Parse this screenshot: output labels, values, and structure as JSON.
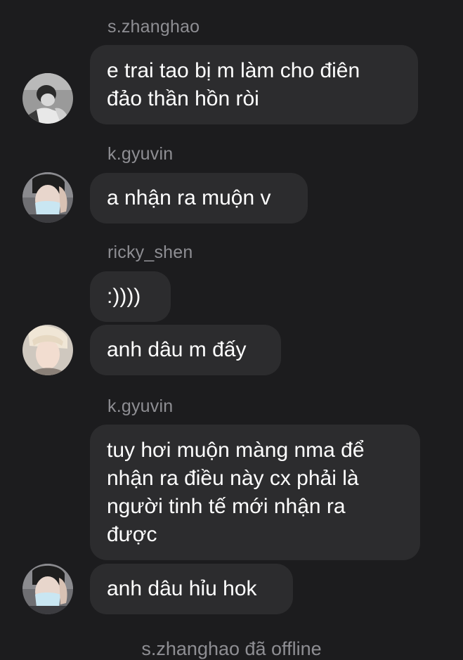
{
  "messages": [
    {
      "sender": "s.zhanghao",
      "text": "e trai tao bị m làm cho điên\nđảo thần hồn ròi",
      "avatar": "avatar-zhanghao"
    },
    {
      "sender": "k.gyuvin",
      "text": "a nhận ra muộn v",
      "avatar": "avatar-gyuvin"
    },
    {
      "sender": "ricky_shen",
      "text": ":))))",
      "avatar": null
    },
    {
      "sender": null,
      "text": "anh dâu m đấy",
      "avatar": "avatar-ricky"
    },
    {
      "sender": "k.gyuvin",
      "text": "tuy hơi muộn màng nma để\nnhận ra điều này cx phải là\nngười tinh tế mới nhận ra\nđược",
      "avatar": null
    },
    {
      "sender": null,
      "text": "anh dâu hỉu hok",
      "avatar": "avatar-gyuvin"
    }
  ],
  "system_note": "s.zhanghao đã offline",
  "colors": {
    "background": "#1c1c1e",
    "bubble": "#2c2c2e",
    "text": "#ffffff",
    "sender": "#8e8e93"
  }
}
